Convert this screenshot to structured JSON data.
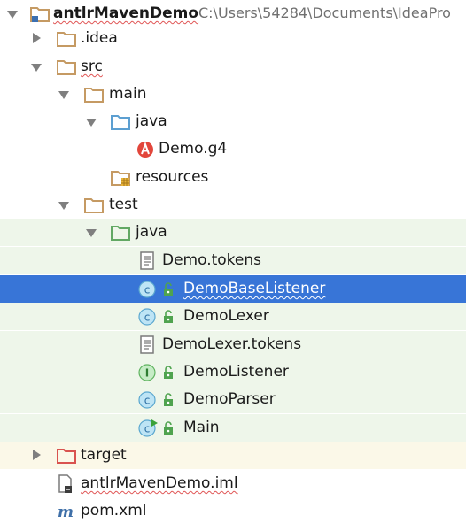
{
  "project": {
    "name": "antlrMavenDemo",
    "path": "C:\\Users\\54284\\Documents\\IdeaPro"
  },
  "tree": {
    "idea": ".idea",
    "src": "src",
    "main": "main",
    "main_java": "java",
    "demo_g4": "Demo.g4",
    "resources": "resources",
    "test": "test",
    "test_java": "java",
    "demo_tokens": "Demo.tokens",
    "demo_base_listener": "DemoBaseListener",
    "demo_lexer": "DemoLexer",
    "demo_lexer_tokens": "DemoLexer.tokens",
    "demo_listener": "DemoListener",
    "demo_parser": "DemoParser",
    "main_class": "Main",
    "target": "target",
    "iml": "antlrMavenDemo.iml",
    "pom": "pom.xml"
  },
  "icons": {
    "folder": "folder-icon",
    "source_folder": "source-folder-icon",
    "test_folder": "test-folder-icon",
    "resources_folder": "resources-folder-icon",
    "excluded_folder": "excluded-folder-icon",
    "antlr": "antlr-file-icon",
    "text_file": "text-file-icon",
    "class": "class-icon",
    "interface": "interface-icon",
    "runnable_class": "runnable-class-icon",
    "iml": "iml-file-icon",
    "maven": "maven-icon"
  },
  "colors": {
    "selection": "#3875d7",
    "test_highlight": "#eef6ea",
    "target_highlight": "#fbf8e8",
    "folder": "#c59a63",
    "source_folder": "#5c9fd1",
    "test_folder": "#62a864",
    "excluded_folder": "#d9534f"
  }
}
